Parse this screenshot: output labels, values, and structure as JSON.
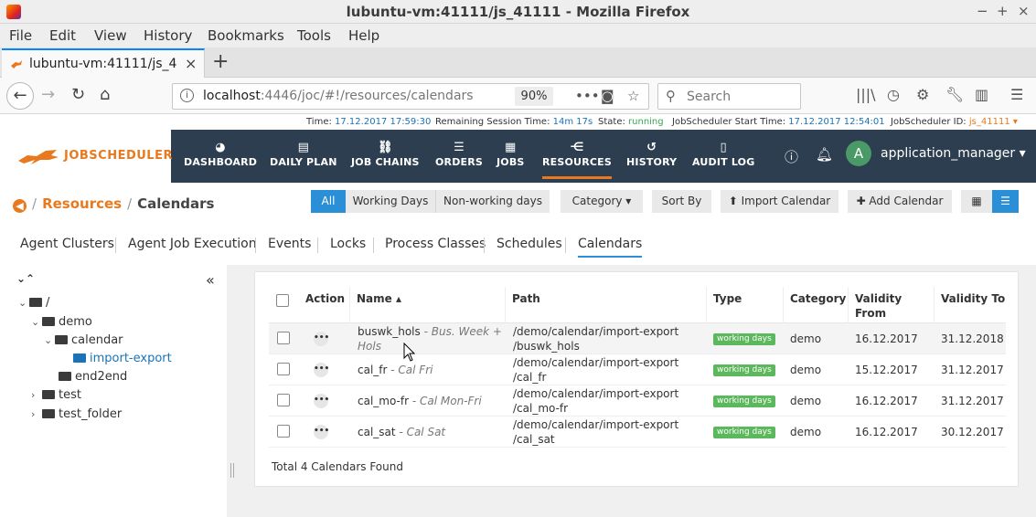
{
  "window": {
    "title": "lubuntu-vm:41111/js_41111 - Mozilla Firefox",
    "minimize": "−",
    "maximize": "+",
    "close": "×"
  },
  "menu": [
    "File",
    "Edit",
    "View",
    "History",
    "Bookmarks",
    "Tools",
    "Help"
  ],
  "tab": {
    "title": "lubuntu-vm:41111/js_41",
    "close": "×",
    "new": "+"
  },
  "nav": {
    "url_host": "localhost",
    "url_rest": ":4446/joc/#!/resources/calendars",
    "zoom": "90%",
    "search_placeholder": "Search"
  },
  "status": {
    "time_label": "Time:",
    "time": "17.12.2017 17:59:30",
    "session_label": "Remaining Session Time:",
    "session": "14m 17s",
    "state_label": "State:",
    "state": "running",
    "start_label": "JobScheduler Start Time:",
    "start": "17.12.2017 12:54:01",
    "id_label": "JobScheduler ID:",
    "id": "js_41111 ▾"
  },
  "app": {
    "logo": "JOBSCHEDULER",
    "nav": [
      "DASHBOARD",
      "DAILY PLAN",
      "JOB CHAINS",
      "ORDERS",
      "JOBS",
      "RESOURCES",
      "HISTORY",
      "AUDIT LOG"
    ],
    "avatar": "A",
    "user": "application_manager ▾"
  },
  "page": {
    "crumb_resources": "Resources",
    "crumb_calendars": "Calendars",
    "filters": [
      "All",
      "Working Days",
      "Non-working days"
    ],
    "category": "Category ▾",
    "sort_by": "Sort By",
    "import": "⬆ Import Calendar",
    "add": "✚ Add Calendar"
  },
  "subtabs": [
    "Agent Clusters",
    "Agent Job Execution",
    "Events",
    "Locks",
    "Process Classes",
    "Schedules",
    "Calendars"
  ],
  "tree": {
    "root": "/",
    "demo": "demo",
    "calendar": "calendar",
    "import_export": "import-export",
    "end2end": "end2end",
    "test": "test",
    "test_folder": "test_folder"
  },
  "table": {
    "headers": {
      "action": "Action",
      "name": "Name ▴",
      "path": "Path",
      "type": "Type",
      "category": "Category",
      "validity_from_1": "Validity",
      "validity_from_2": "From",
      "validity_to": "Validity To"
    },
    "rows": [
      {
        "name": "buswk_hols",
        "desc_1": " - Bus. Week +",
        "desc_2": "Hols",
        "path_1": "/demo/calendar/import-export",
        "path_2": "/buswk_hols",
        "type": "working days",
        "category": "demo",
        "from": "16.12.2017",
        "to": "31.12.2018"
      },
      {
        "name": "cal_fr",
        "desc_1": " - Cal Fri",
        "desc_2": "",
        "path_1": "/demo/calendar/import-export",
        "path_2": "/cal_fr",
        "type": "working days",
        "category": "demo",
        "from": "15.12.2017",
        "to": "31.12.2017"
      },
      {
        "name": "cal_mo-fr",
        "desc_1": " - Cal Mon-Fri",
        "desc_2": "",
        "path_1": "/demo/calendar/import-export",
        "path_2": "/cal_mo-fr",
        "type": "working days",
        "category": "demo",
        "from": "16.12.2017",
        "to": "31.12.2017"
      },
      {
        "name": "cal_sat",
        "desc_1": " - Cal Sat",
        "desc_2": "",
        "path_1": "/demo/calendar/import-export",
        "path_2": "/cal_sat",
        "type": "working days",
        "category": "demo",
        "from": "16.12.2017",
        "to": "30.12.2017"
      }
    ],
    "total": "Total 4 Calendars Found"
  },
  "colors": {
    "accent": "#e8791e",
    "header": "#2c3e50",
    "primary": "#2a8fd6",
    "badge": "#5cb85c"
  }
}
